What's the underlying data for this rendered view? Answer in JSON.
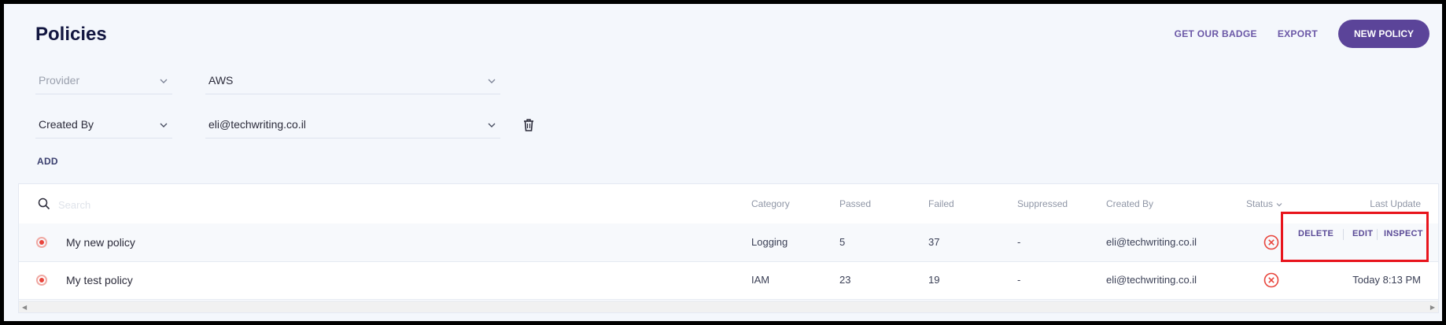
{
  "page": {
    "title": "Policies"
  },
  "header": {
    "get_badge_label": "GET OUR BADGE",
    "export_label": "EXPORT",
    "new_policy_label": "NEW POLICY"
  },
  "filters": [
    {
      "field_placeholder": "Provider",
      "value": "AWS"
    },
    {
      "field": "Created By",
      "value": "eli@techwriting.co.il"
    }
  ],
  "add_label": "ADD",
  "table": {
    "search_placeholder": "Search",
    "headers": {
      "category": "Category",
      "passed": "Passed",
      "failed": "Failed",
      "suppressed": "Suppressed",
      "created_by": "Created By",
      "status": "Status",
      "last_update": "Last Update"
    },
    "rows": [
      {
        "name": "My new policy",
        "category": "Logging",
        "passed": "5",
        "failed": "37",
        "suppressed": "-",
        "created_by": "eli@techwriting.co.il",
        "status_icon": "error-x-icon",
        "last_update": ""
      },
      {
        "name": "My test policy",
        "category": "IAM",
        "passed": "23",
        "failed": "19",
        "suppressed": "-",
        "created_by": "eli@techwriting.co.il",
        "status_icon": "error-x-icon",
        "last_update": "Today 8:13 PM"
      }
    ],
    "row_actions": {
      "delete": "DELETE",
      "edit": "EDIT",
      "inspect": "INSPECT"
    }
  },
  "colors": {
    "accent": "#5b4499",
    "link": "#6a57a6",
    "error": "#e8453c",
    "highlight_box": "#e8141c"
  }
}
